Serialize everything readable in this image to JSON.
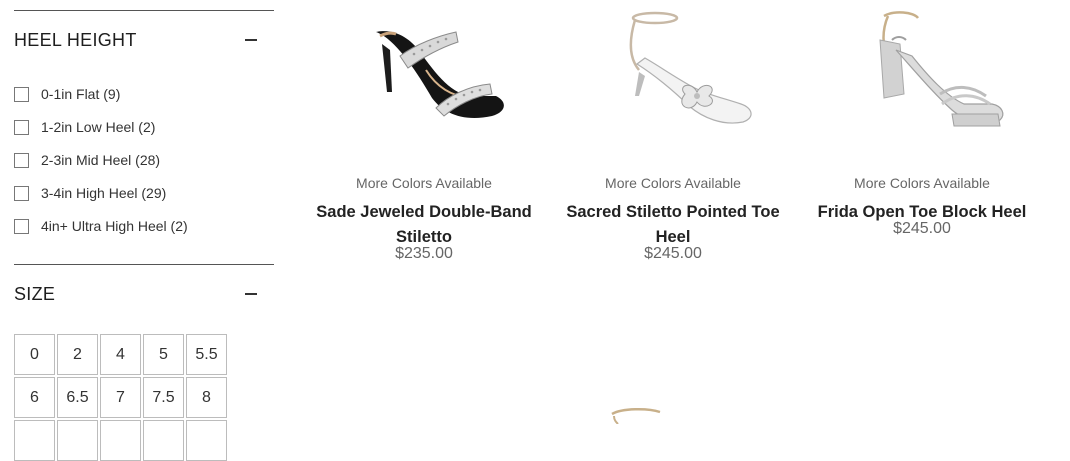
{
  "filters": {
    "heel_height": {
      "title": "HEEL HEIGHT",
      "options": [
        {
          "label": "0-1in Flat (9)"
        },
        {
          "label": "1-2in Low Heel (2)"
        },
        {
          "label": "2-3in Mid Heel (28)"
        },
        {
          "label": "3-4in High Heel (29)"
        },
        {
          "label": "4in+ Ultra High Heel (2)"
        }
      ]
    },
    "size": {
      "title": "SIZE",
      "options": [
        "0",
        "2",
        "4",
        "5",
        "5.5",
        "6",
        "6.5",
        "7",
        "7.5",
        "8",
        "",
        "",
        "",
        "",
        ""
      ]
    }
  },
  "products": [
    {
      "more_colors": "More Colors Available",
      "name_line1": "Sade Jeweled Double-Band",
      "name_line2": "Stiletto",
      "price": "$235.00",
      "image": "black-jeweled-double-band-stiletto"
    },
    {
      "more_colors": "More Colors Available",
      "name_line1": "Sacred Stiletto Pointed Toe",
      "name_line2": "Heel",
      "price": "$245.00",
      "image": "white-pointed-toe-bow-stiletto"
    },
    {
      "more_colors": "More Colors Available",
      "name_line1": "Frida Open Toe Block Heel",
      "name_line2": "",
      "price": "$245.00",
      "image": "silver-open-toe-block-heel"
    }
  ],
  "icons": {
    "collapse": "minus-icon",
    "checkbox": "checkbox-icon"
  },
  "colors": {
    "text": "#222222",
    "muted": "#666666",
    "rule": "#555555",
    "border": "#bcbcbc"
  }
}
